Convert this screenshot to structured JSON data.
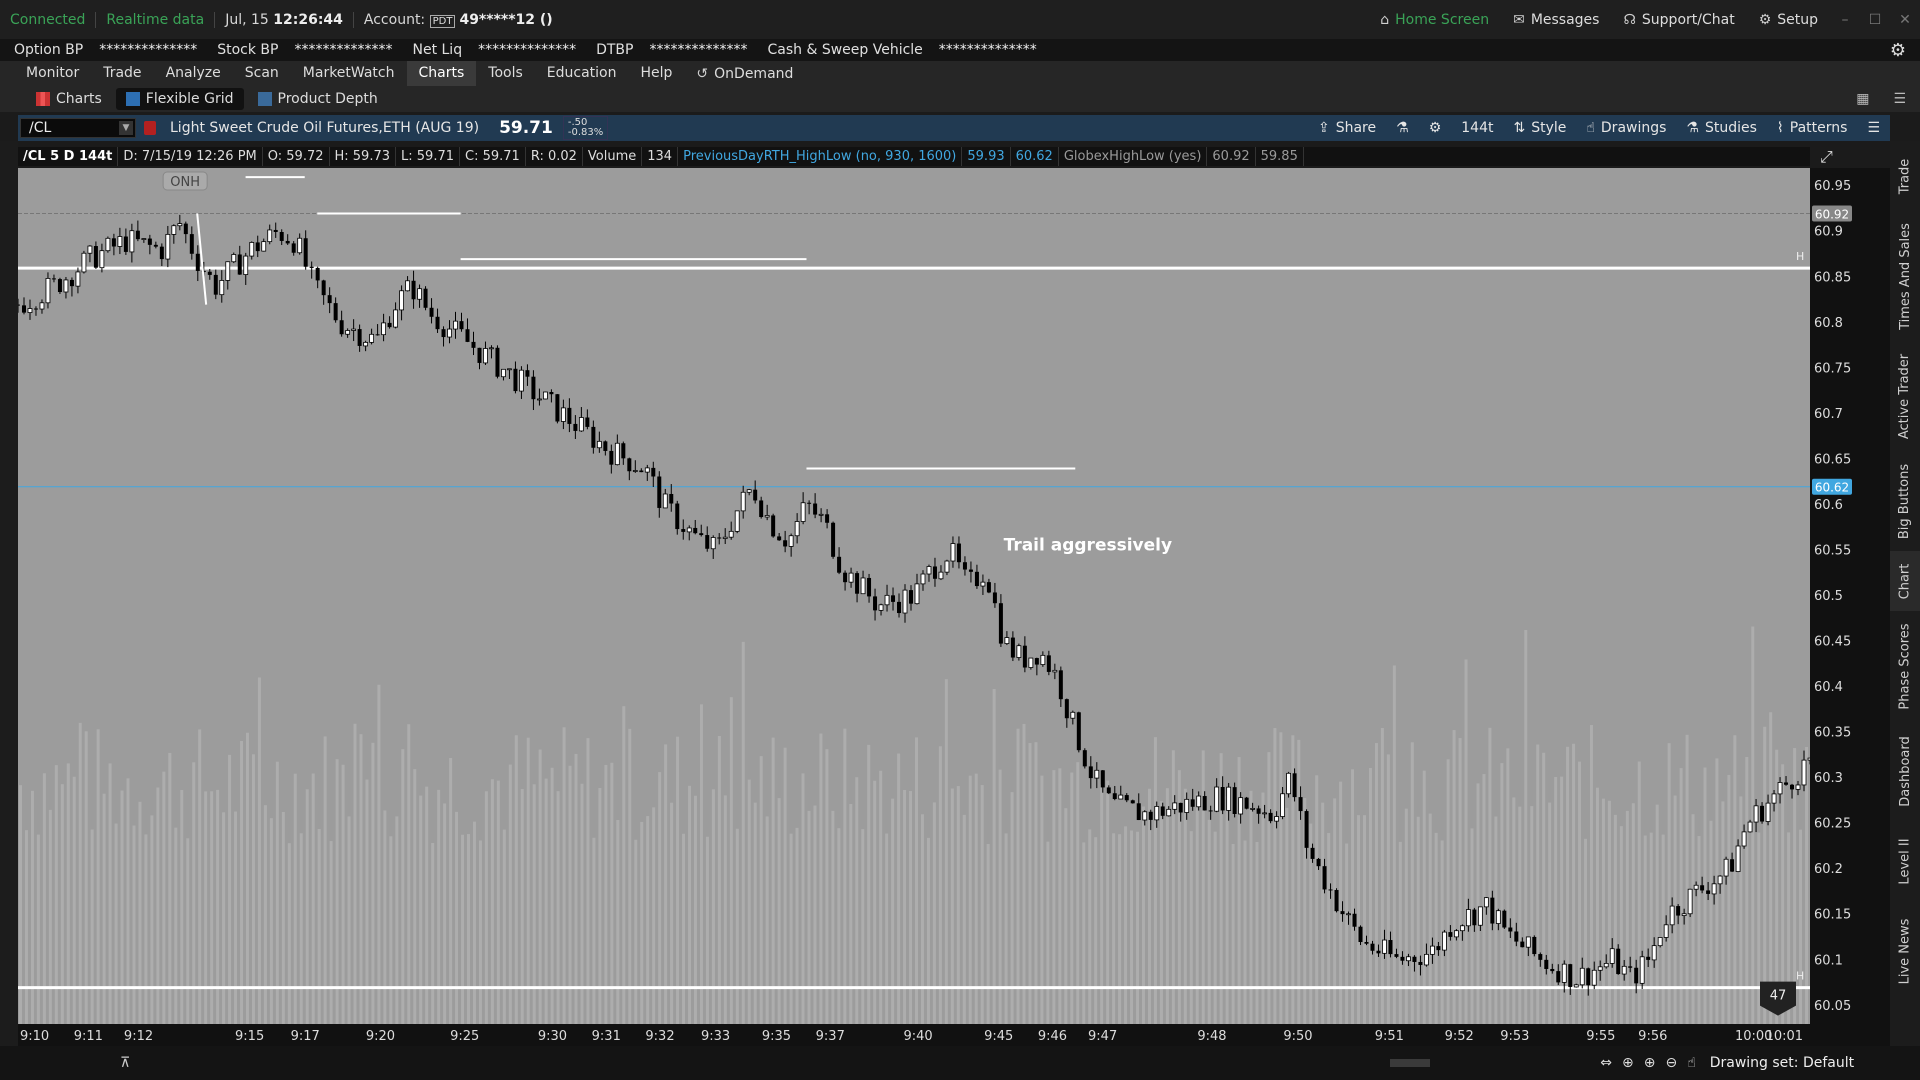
{
  "status": {
    "connected": "Connected",
    "realtime": "Realtime data",
    "date": "Jul, 15",
    "time": "12:26:44",
    "account_label": "Account:",
    "account_tag": "PDT",
    "account_value": "49*****12 ()",
    "home": "Home Screen",
    "messages": "Messages",
    "support": "Support/Chat",
    "setup": "Setup"
  },
  "bp": {
    "option_bp": "Option BP",
    "stock_bp": "Stock BP",
    "net_liq": "Net Liq",
    "dtbp": "DTBP",
    "cash": "Cash & Sweep Vehicle",
    "mask": "**************"
  },
  "nav": {
    "items": [
      "Monitor",
      "Trade",
      "Analyze",
      "Scan",
      "MarketWatch",
      "Charts",
      "Tools",
      "Education",
      "Help"
    ],
    "ondemand": "OnDemand"
  },
  "subnav": {
    "charts": "Charts",
    "flexible_grid": "Flexible Grid",
    "product_depth": "Product Depth"
  },
  "toolbar": {
    "symbol": "/CL",
    "description": "Light Sweet Crude Oil Futures,ETH (AUG 19)",
    "last": "59.71",
    "change": "-.50",
    "change_pct": "-0.83%",
    "share": "Share",
    "aggregation": "144t",
    "style": "Style",
    "drawings": "Drawings",
    "studies": "Studies",
    "patterns": "Patterns"
  },
  "info": {
    "symbol_period": "/CL 5 D 144t",
    "date": "D: 7/15/19 12:26 PM",
    "open": "O: 59.72",
    "high": "H: 59.73",
    "low": "L: 59.71",
    "close": "C: 59.71",
    "range": "R: 0.02",
    "volume_label": "Volume",
    "volume": "134",
    "study1": "PreviousDayRTH_HighLow (no, 930, 1600)",
    "study1_v1": "59.93",
    "study1_v2": "60.62",
    "study2": "GlobexHighLow (yes)",
    "study2_v1": "60.92",
    "study2_v2": "59.85"
  },
  "chart_data": {
    "type": "candlestick",
    "y_ticks": [
      60.05,
      60.1,
      60.15,
      60.2,
      60.25,
      60.3,
      60.35,
      60.4,
      60.45,
      60.5,
      60.55,
      60.6,
      60.65,
      60.7,
      60.75,
      60.8,
      60.85,
      60.9,
      60.95
    ],
    "ylim": [
      60.03,
      60.97
    ],
    "x_ticks": [
      "9:10",
      "9:11",
      "9:12",
      "9:15",
      "9:17",
      "9:20",
      "9:25",
      "9:30",
      "9:31",
      "9:32",
      "9:33",
      "9:35",
      "9:37",
      "9:40",
      "9:45",
      "9:46",
      "9:47",
      "9:48",
      "9:50",
      "9:51",
      "9:52",
      "9:53",
      "9:55",
      "9:56",
      "10:00",
      "10:01"
    ],
    "close_path": [
      [
        0,
        60.82
      ],
      [
        0.02,
        60.84
      ],
      [
        0.04,
        60.87
      ],
      [
        0.06,
        60.89
      ],
      [
        0.08,
        60.88
      ],
      [
        0.09,
        60.91
      ],
      [
        0.1,
        60.87
      ],
      [
        0.11,
        60.84
      ],
      [
        0.12,
        60.86
      ],
      [
        0.13,
        60.88
      ],
      [
        0.145,
        60.9
      ],
      [
        0.155,
        60.89
      ],
      [
        0.165,
        60.84
      ],
      [
        0.18,
        60.8
      ],
      [
        0.2,
        60.78
      ],
      [
        0.21,
        60.82
      ],
      [
        0.22,
        60.84
      ],
      [
        0.23,
        60.81
      ],
      [
        0.25,
        60.78
      ],
      [
        0.27,
        60.75
      ],
      [
        0.29,
        60.72
      ],
      [
        0.31,
        60.69
      ],
      [
        0.33,
        60.66
      ],
      [
        0.35,
        60.64
      ],
      [
        0.36,
        60.6
      ],
      [
        0.38,
        60.56
      ],
      [
        0.39,
        60.55
      ],
      [
        0.4,
        60.59
      ],
      [
        0.41,
        60.62
      ],
      [
        0.42,
        60.58
      ],
      [
        0.43,
        60.56
      ],
      [
        0.44,
        60.6
      ],
      [
        0.45,
        60.58
      ],
      [
        0.46,
        60.53
      ],
      [
        0.48,
        60.49
      ],
      [
        0.5,
        60.5
      ],
      [
        0.51,
        60.53
      ],
      [
        0.52,
        60.55
      ],
      [
        0.53,
        60.51
      ],
      [
        0.54,
        60.53
      ],
      [
        0.55,
        60.45
      ],
      [
        0.56,
        60.43
      ],
      [
        0.57,
        60.44
      ],
      [
        0.58,
        60.41
      ],
      [
        0.59,
        60.35
      ],
      [
        0.6,
        60.3
      ],
      [
        0.61,
        60.27
      ],
      [
        0.63,
        60.26
      ],
      [
        0.65,
        60.27
      ],
      [
        0.67,
        60.28
      ],
      [
        0.69,
        60.27
      ],
      [
        0.7,
        60.26
      ],
      [
        0.71,
        60.3
      ],
      [
        0.72,
        60.22
      ],
      [
        0.74,
        60.15
      ],
      [
        0.75,
        60.12
      ],
      [
        0.77,
        60.1
      ],
      [
        0.79,
        60.11
      ],
      [
        0.8,
        60.14
      ],
      [
        0.82,
        60.16
      ],
      [
        0.83,
        60.13
      ],
      [
        0.85,
        60.1
      ],
      [
        0.87,
        60.08
      ],
      [
        0.88,
        60.09
      ],
      [
        0.89,
        60.1
      ],
      [
        0.9,
        60.08
      ],
      [
        0.91,
        60.1
      ],
      [
        0.92,
        60.15
      ],
      [
        0.94,
        60.18
      ],
      [
        0.955,
        60.2
      ],
      [
        0.965,
        60.25
      ],
      [
        0.98,
        60.28
      ],
      [
        1,
        60.32
      ]
    ],
    "levels": [
      {
        "name": "globex-high",
        "value": 60.92,
        "color": "#777777"
      },
      {
        "name": "rth-high",
        "value": 60.62,
        "color": "#41a7e0"
      }
    ],
    "h_lines": [
      60.86,
      60.07
    ],
    "segments": [
      {
        "x0": 0.127,
        "x1": 0.16,
        "y": 60.96
      },
      {
        "x0": 0.167,
        "x1": 0.247,
        "y": 60.92
      },
      {
        "x0": 0.247,
        "x1": 0.44,
        "y": 60.87
      },
      {
        "x0": 0.44,
        "x1": 0.59,
        "y": 60.64
      }
    ],
    "axis_badges": [
      "60.92",
      "60.62"
    ],
    "annotations": {
      "onh": "ONH",
      "trail": "Trail aggressively",
      "badge": "47",
      "h_marker": "H"
    }
  },
  "vtabs": [
    "Trade",
    "Times And Sales",
    "Active Trader",
    "Big Buttons",
    "Chart",
    "Phase Scores",
    "Dashboard",
    "Level II",
    "Live News"
  ],
  "footer": {
    "drawing_set": "Drawing set: Default"
  }
}
